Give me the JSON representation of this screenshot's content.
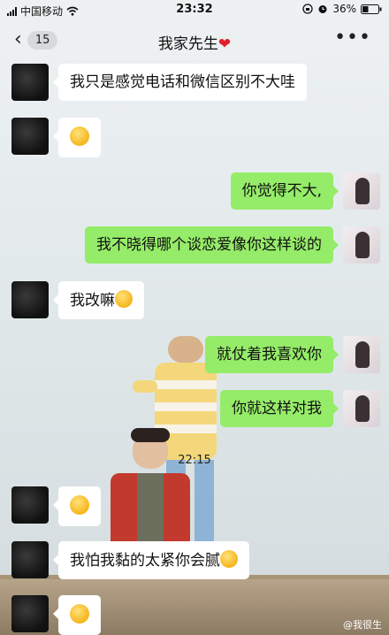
{
  "status_bar": {
    "carrier": "中国移动",
    "time": "23:32",
    "battery": "36%"
  },
  "nav": {
    "unread_count": "15",
    "title": "我家先生",
    "title_emoji": "❤",
    "more_label": "•••"
  },
  "messages": [
    {
      "side": "left",
      "text": "我只是感觉电话和微信区别不大哇"
    },
    {
      "side": "left",
      "text": "",
      "emoji": "smirk-face"
    },
    {
      "side": "right",
      "text": "你觉得不大,"
    },
    {
      "side": "right",
      "text": "我不晓得哪个谈恋爱像你这样谈的"
    },
    {
      "side": "left",
      "text": "我改嘛",
      "emoji": "smile-face"
    },
    {
      "side": "right",
      "text": "就仗着我喜欢你"
    },
    {
      "side": "right",
      "text": "你就这样对我"
    },
    {
      "side": "left",
      "text": "",
      "emoji": "laugh-cry-face"
    },
    {
      "side": "left",
      "text": "我怕我黏的太紧你会腻",
      "emoji": "grin-face"
    },
    {
      "side": "left",
      "text": "",
      "emoji": "laugh-cry-face"
    }
  ],
  "timestamp": "22:15",
  "watermark": "@我很生"
}
